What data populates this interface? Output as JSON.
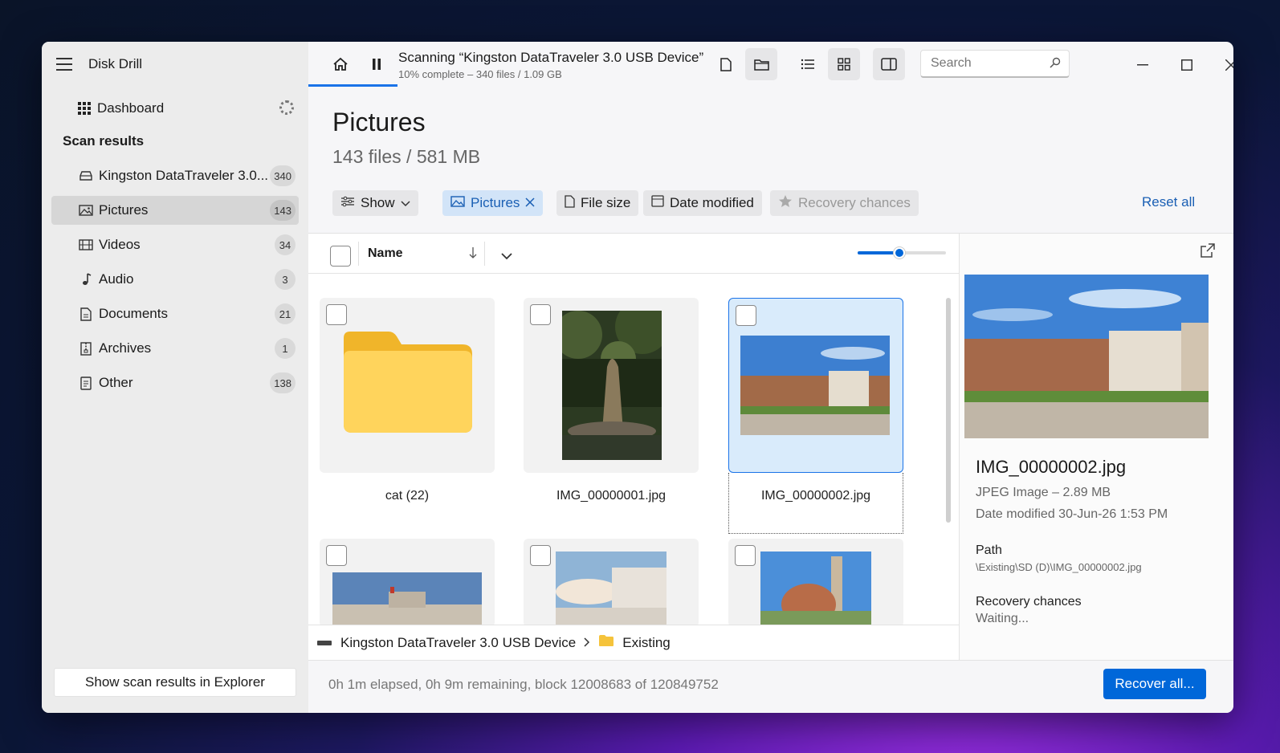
{
  "app": {
    "name": "Disk Drill"
  },
  "sidebar": {
    "dashboard_label": "Dashboard",
    "section_title": "Scan results",
    "items": [
      {
        "label": "Kingston DataTraveler 3.0...",
        "count": "340",
        "icon": "drive-icon"
      },
      {
        "label": "Pictures",
        "count": "143",
        "icon": "picture-icon",
        "selected": true
      },
      {
        "label": "Videos",
        "count": "34",
        "icon": "film-icon"
      },
      {
        "label": "Audio",
        "count": "3",
        "icon": "music-note-icon"
      },
      {
        "label": "Documents",
        "count": "21",
        "icon": "document-icon"
      },
      {
        "label": "Archives",
        "count": "1",
        "icon": "archive-icon"
      },
      {
        "label": "Other",
        "count": "138",
        "icon": "other-file-icon"
      }
    ],
    "explorer_button": "Show scan results in Explorer"
  },
  "toolbar": {
    "scan_title": "Scanning “Kingston DataTraveler 3.0 USB Device”",
    "scan_subtitle": "10% complete – 340 files / 1.09 GB",
    "search_placeholder": "Search"
  },
  "page": {
    "title": "Pictures",
    "subtitle": "143 files / 581 MB"
  },
  "filters": {
    "show": "Show",
    "pictures": "Pictures",
    "file_size": "File size",
    "date_modified": "Date modified",
    "recovery_chances": "Recovery chances",
    "reset_all": "Reset all"
  },
  "list": {
    "column_name": "Name",
    "items": [
      {
        "name": "cat (22)",
        "type": "folder"
      },
      {
        "name": "IMG_00000001.jpg",
        "type": "image"
      },
      {
        "name": "IMG_00000002.jpg",
        "type": "image",
        "selected": true
      },
      {
        "name": "",
        "type": "image"
      },
      {
        "name": "",
        "type": "image"
      },
      {
        "name": "",
        "type": "image"
      }
    ]
  },
  "breadcrumb": {
    "device": "Kingston DataTraveler 3.0 USB Device",
    "folder": "Existing"
  },
  "preview": {
    "file_name": "IMG_00000002.jpg",
    "file_type": "JPEG Image – 2.89 MB",
    "date_modified": "Date modified 30-Jun-26 1:53 PM",
    "path_label": "Path",
    "path_value": "\\Existing\\SD (D)\\IMG_00000002.jpg",
    "recovery_label": "Recovery chances",
    "recovery_value": "Waiting..."
  },
  "status": {
    "text": "0h 1m elapsed, 0h 9m remaining, block 12008683 of 120849752",
    "recover_button": "Recover all..."
  },
  "colors": {
    "accent": "#0067d9",
    "selection": "#d9ebfb",
    "chip_active": "#d2e4f8"
  }
}
